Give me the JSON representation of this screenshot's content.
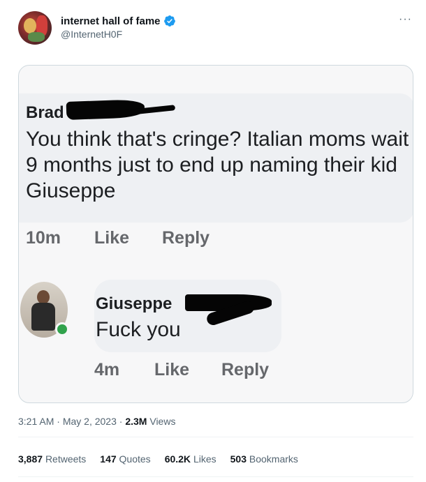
{
  "author": {
    "display_name": "internet hall of fame",
    "handle": "@InternetH0F",
    "verified_icon": "verified-badge-icon",
    "accent": "#1d9bf0"
  },
  "menu": {
    "more_label": "···"
  },
  "media": {
    "comment1": {
      "name": "Brad",
      "text": "You think that's cringe? Italian moms wait 9 months just to end up naming their kid Giuseppe",
      "time": "10m",
      "like": "Like",
      "reply": "Reply"
    },
    "comment2": {
      "name": "Giuseppe",
      "text": "Fuck you",
      "time": "4m",
      "like": "Like",
      "reply": "Reply",
      "online_color": "#31a24c"
    }
  },
  "footer": {
    "time": "3:21 AM",
    "sep1": "·",
    "date": "May 2, 2023",
    "sep2": "·",
    "views_count": "2.3M",
    "views_label": "Views",
    "retweets_count": "3,887",
    "retweets_label": "Retweets",
    "quotes_count": "147",
    "quotes_label": "Quotes",
    "likes_count": "60.2K",
    "likes_label": "Likes",
    "bookmarks_count": "503",
    "bookmarks_label": "Bookmarks"
  }
}
